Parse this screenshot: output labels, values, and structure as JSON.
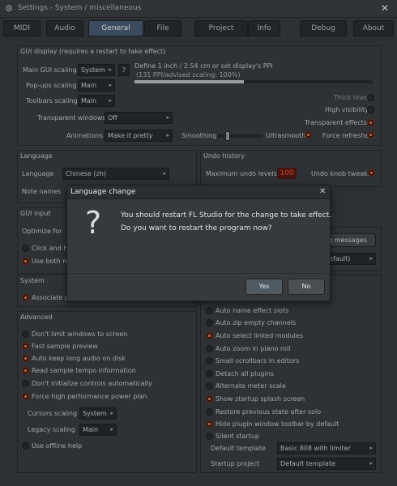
{
  "window": {
    "title": "Settings - System / miscellaneous",
    "close_glyph": "✕"
  },
  "tabs": [
    {
      "label": "MIDI"
    },
    {
      "label": "Audio"
    },
    {
      "label": "General",
      "active": true
    },
    {
      "label": "File"
    },
    {
      "label": "Project"
    },
    {
      "label": "Info"
    },
    {
      "label": "Debug"
    },
    {
      "label": "About"
    }
  ],
  "gui_display": {
    "title": "GUI display (requires a restart to take effect)",
    "main_scaling_label": "Main GUI scaling",
    "main_scaling_value": "System",
    "popup_scaling_label": "Pop-ups scaling",
    "popup_scaling_value": "Main",
    "toolbar_scaling_label": "Toolbars scaling",
    "toolbar_scaling_value": "Main",
    "transparent_label": "Transparent windows",
    "transparent_value": "Off",
    "animations_label": "Animations",
    "animations_value": "Make it pretty",
    "ppi_text": "Define 1 inch / 2.54 cm or set display's PPI",
    "ppi_sub": "(131 PPI/advised scaling: 100%)",
    "ppi_fill": 0.46,
    "thick_lines": "Thick lines",
    "high_visibility": "High visibility",
    "transparent_effects": "Transparent effects",
    "force_refreshes": "Force refreshes",
    "smoothing_label": "Smoothing",
    "ultrasmooth": "Ultrasmooth",
    "help_glyph": "?"
  },
  "language": {
    "title": "Language",
    "label": "Language",
    "value": "Chinese (zh)",
    "note_label": "Note names"
  },
  "undo": {
    "title": "Undo history",
    "max_label": "Maximum undo levels",
    "max_value": "100",
    "knob_tweaks": "Undo knob tweaks"
  },
  "gui_input": {
    "title": "GUI input",
    "optimize_label": "Optimize for",
    "click_hold": "Click and h",
    "use_both": "Use both m"
  },
  "right_mid": {
    "messages_btn": "g messages",
    "default_val": "(default)"
  },
  "system": {
    "title": "System",
    "item": "Associate p"
  },
  "advanced": {
    "title": "Advanced",
    "items": [
      {
        "label": "Don't limit windows to screen",
        "on": false
      },
      {
        "label": "Fast sample preview",
        "on": true
      },
      {
        "label": "Auto keep long audio on disk",
        "on": true
      },
      {
        "label": "Read sample tempo information",
        "on": true
      },
      {
        "label": "Don't initialize controls automatically",
        "on": false
      },
      {
        "label": "Force high performance power plan",
        "on": true
      }
    ],
    "cursors_label": "Cursors scaling",
    "cursors_value": "System",
    "legacy_label": "Legacy scaling",
    "legacy_value": "Main",
    "offline_help": "Use offline help"
  },
  "misc": {
    "items": [
      {
        "label": "Auto name effect slots",
        "on": false
      },
      {
        "label": "Auto zip empty channels",
        "on": false
      },
      {
        "label": "Auto select linked modules",
        "on": true
      },
      {
        "label": "Auto zoom in piano roll",
        "on": false
      },
      {
        "label": "Small scrollbars in editors",
        "on": false
      },
      {
        "label": "Detach all plugins",
        "on": false
      },
      {
        "label": "Alternate meter scale",
        "on": false
      },
      {
        "label": "Show startup splash screen",
        "on": true
      },
      {
        "label": "Restore previous state after solo",
        "on": false
      },
      {
        "label": "Hide plugin window toolbar by default",
        "on": true
      },
      {
        "label": "Silent startup",
        "on": false
      }
    ],
    "default_template_label": "Default template",
    "default_template_value": "Basic 808 with limiter",
    "startup_project_label": "Startup project",
    "startup_project_value": "Default template"
  },
  "dialog": {
    "title": "Language change",
    "question_glyph": "?",
    "close_glyph": "✕",
    "line1": "You should restart FL Studio for the change to take effect.",
    "line2": "Do you want to restart the program now?",
    "yes": "Yes",
    "no": "No"
  },
  "colors": {
    "accent_orange": "#e26a45",
    "active_tab": "#4b6279",
    "bg": "#3b3f42"
  }
}
